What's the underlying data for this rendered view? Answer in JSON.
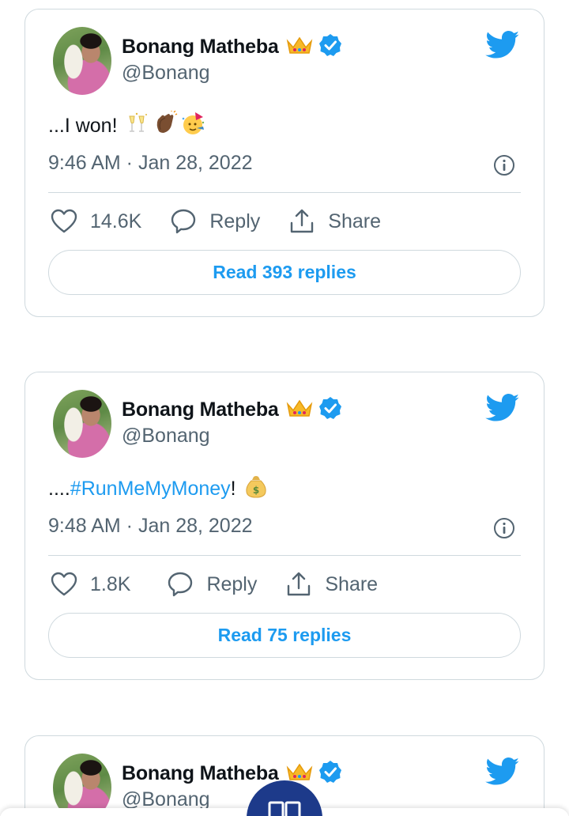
{
  "tweets": [
    {
      "author_name": "Bonang Matheba",
      "handle": "@Bonang",
      "text_prefix": "...I won!",
      "hashtag": "",
      "text_suffix": "",
      "timestamp": "9:46 AM · Jan 28, 2022",
      "likes": "14.6K",
      "reply_label": "Reply",
      "share_label": "Share",
      "read_replies": "Read 393 replies",
      "emojis": [
        "champagne-toast-icon",
        "clapping-hands-icon",
        "party-face-icon"
      ]
    },
    {
      "author_name": "Bonang Matheba",
      "handle": "@Bonang",
      "text_prefix": "....",
      "hashtag": "#RunMeMyMoney",
      "text_suffix": "!",
      "timestamp": "9:48 AM · Jan 28, 2022",
      "likes": "1.8K",
      "reply_label": "Reply",
      "share_label": "Share",
      "read_replies": "Read 75 replies",
      "emojis": [
        "money-bag-icon"
      ]
    },
    {
      "author_name": "Bonang Matheba",
      "handle": "@Bonang"
    }
  ],
  "colors": {
    "accent": "#1d9bf0",
    "secondary_text": "#536471",
    "border": "#cfd9de",
    "fab": "#1d3a8a"
  }
}
